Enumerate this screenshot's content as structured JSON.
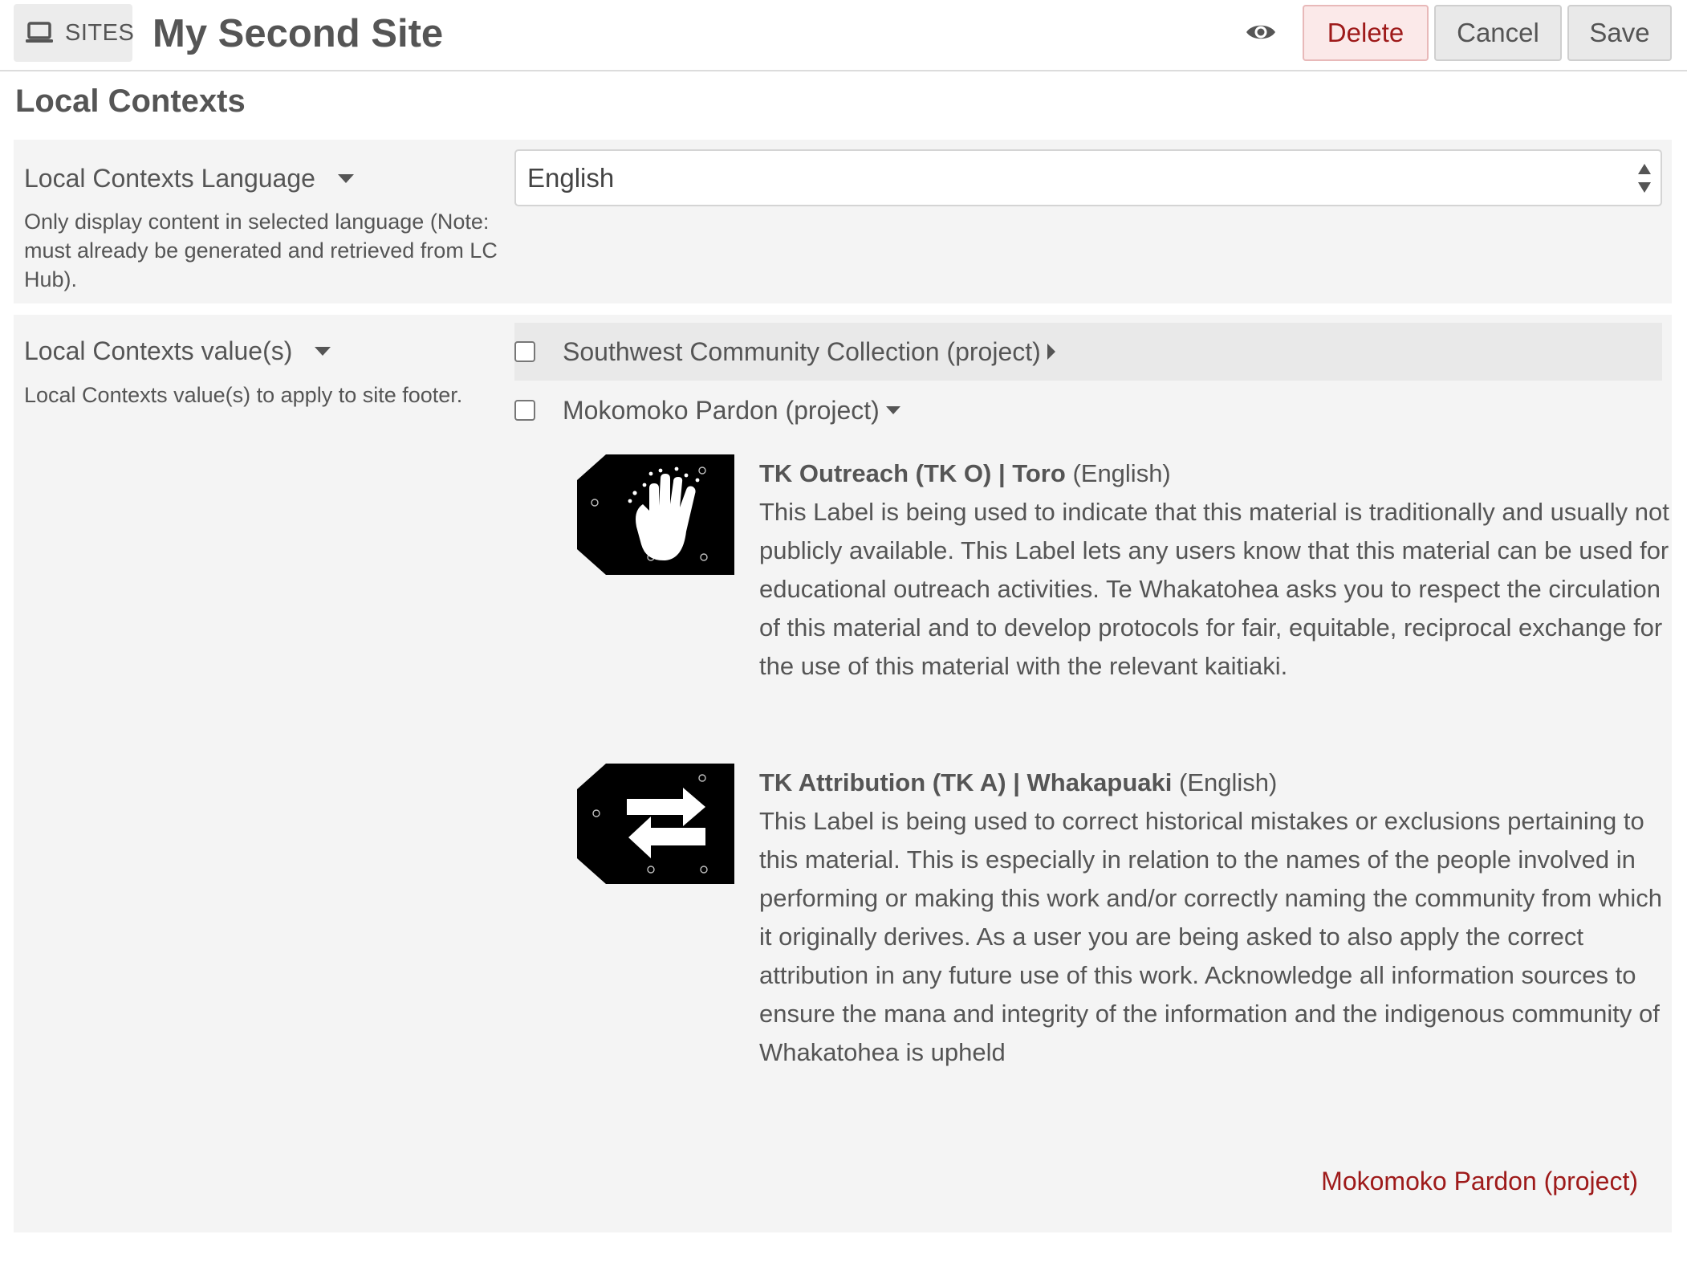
{
  "topbar": {
    "sites_label": "SITES",
    "site_title": "My Second Site",
    "delete_label": "Delete",
    "cancel_label": "Cancel",
    "save_label": "Save"
  },
  "section": {
    "heading": "Local Contexts"
  },
  "language_field": {
    "label": "Local Contexts Language",
    "help": "Only display content in selected language (Note: must already be generated and retrieved from LC Hub).",
    "selected_value": "English"
  },
  "values_field": {
    "label": "Local Contexts value(s)",
    "help": "Local Contexts value(s) to apply to site footer.",
    "projects": [
      {
        "name": "Southwest Community Collection (project)",
        "checked": false,
        "expanded": false
      },
      {
        "name": "Mokomoko Pardon (project)",
        "checked": false,
        "expanded": true
      }
    ],
    "labels": [
      {
        "title": "TK Outreach (TK O) | Toro",
        "language": "(English)",
        "icon": "tk-outreach-hand-icon",
        "description": "This Label is being used to indicate that this material is traditionally and usually not publicly available. This Label lets any users know that this material can be used for educational outreach activities. Te Whakatohea asks you to respect the circulation of this material and to develop protocols for fair, equitable, reciprocal exchange for the use of this material with the relevant kaitiaki."
      },
      {
        "title": "TK Attribution (TK A) | Whakapuaki",
        "language": "(English)",
        "icon": "tk-attribution-arrows-icon",
        "description": "This Label is being used to correct historical mistakes or exclusions pertaining to this material. This is especially in relation to the names of the people involved in performing or making this work and/or correctly naming the community from which it originally derives. As a user you are being asked to also apply the correct attribution in any future use of this work. Acknowledge all information sources to ensure the mana and integrity of the information and the indigenous community of Whakatohea is upheld"
      }
    ],
    "footer_link": "Mokomoko Pardon (project)"
  },
  "colors": {
    "danger": "#9e1a1a",
    "panel_bg": "#f4f4f4",
    "text": "#555555"
  }
}
